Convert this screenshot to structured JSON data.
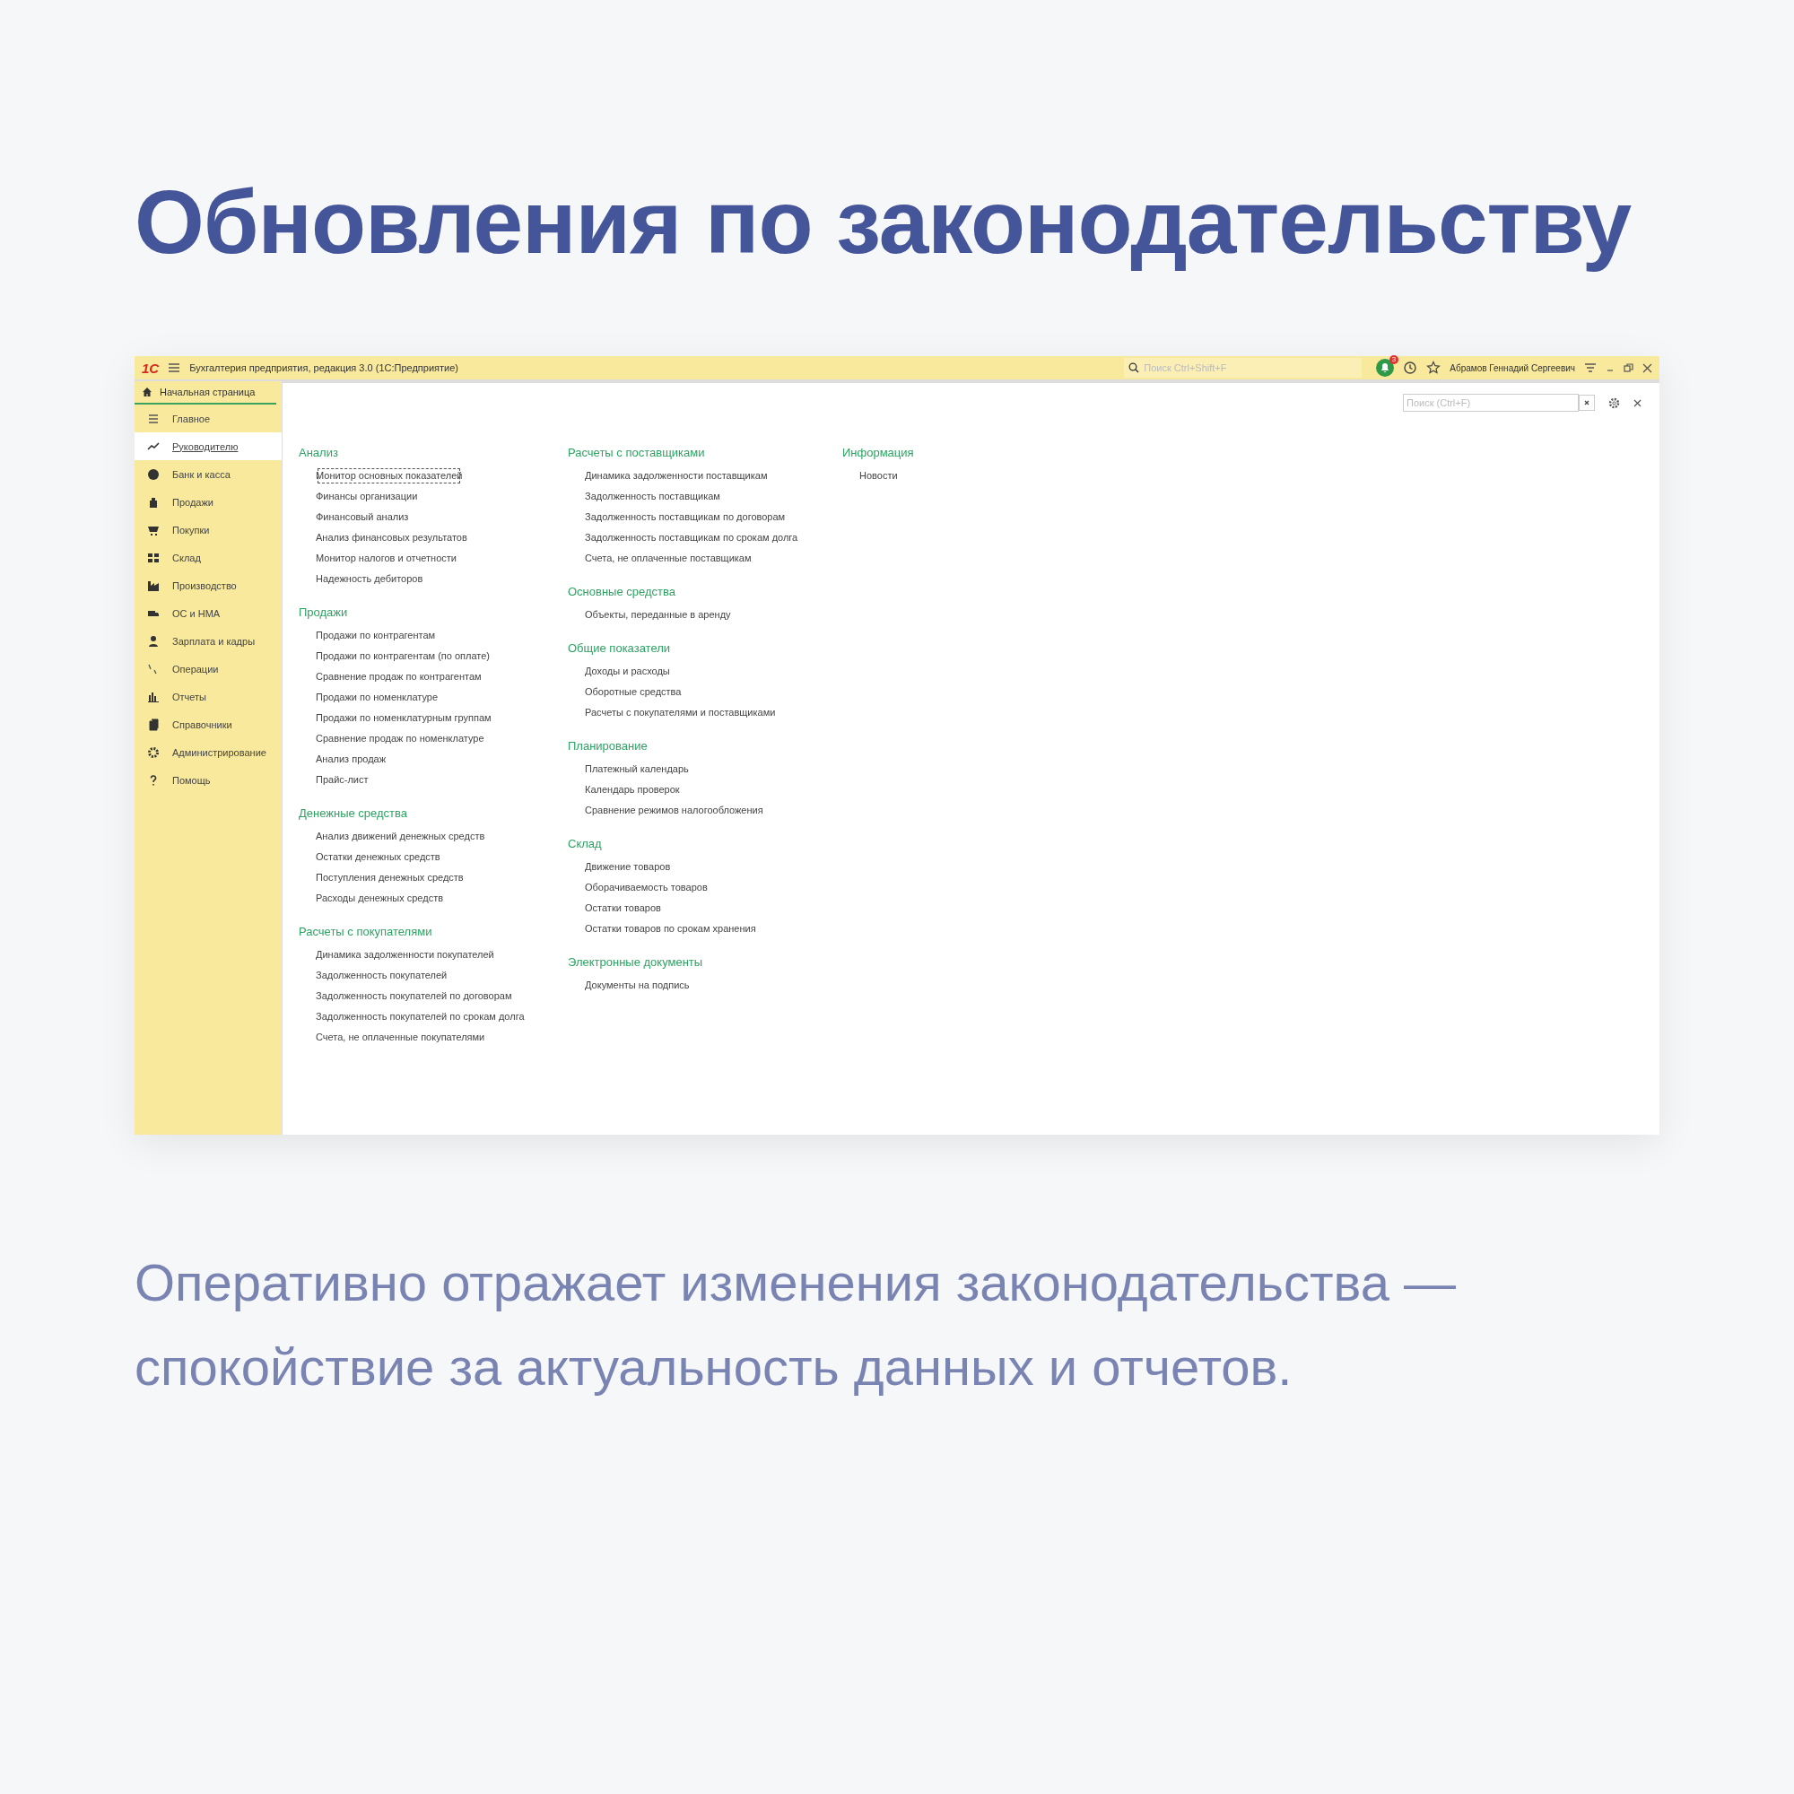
{
  "title": "Обновления по законодательству",
  "window": {
    "logo": "1С",
    "title": "Бухгалтерия предприятия, редакция 3.0  (1С:Предприятие)",
    "search": {
      "placeholder": "Поиск Ctrl+Shift+F"
    },
    "notifications": "3",
    "user": "Абрамов Геннадий Сергеевич"
  },
  "tab": {
    "label": "Начальная страница",
    "selected": true
  },
  "sidebar": {
    "items": [
      {
        "label": "Главное",
        "selected": false
      },
      {
        "label": "Руководителю",
        "selected": true
      },
      {
        "label": "Банк и касса",
        "selected": false
      },
      {
        "label": "Продажи",
        "selected": false
      },
      {
        "label": "Покупки",
        "selected": false
      },
      {
        "label": "Склад",
        "selected": false
      },
      {
        "label": "Производство",
        "selected": false
      },
      {
        "label": "ОС и НМА",
        "selected": false
      },
      {
        "label": "Зарплата и кадры",
        "selected": false
      },
      {
        "label": "Операции",
        "selected": false
      },
      {
        "label": "Отчеты",
        "selected": false
      },
      {
        "label": "Справочники",
        "selected": false
      },
      {
        "label": "Администрирование",
        "selected": false
      },
      {
        "label": "Помощь",
        "selected": false
      }
    ]
  },
  "content": {
    "search": {
      "placeholder": "Поиск (Ctrl+F)"
    },
    "columns": [
      [
        {
          "heading": "Анализ",
          "items": [
            {
              "label": "Монитор основных показателей",
              "focused": true
            },
            {
              "label": "Финансы организации",
              "focused": false
            },
            {
              "label": "Финансовый анализ",
              "focused": false
            },
            {
              "label": "Анализ финансовых результатов",
              "focused": false
            },
            {
              "label": "Монитор налогов и отчетности",
              "focused": false
            },
            {
              "label": "Надежность дебиторов",
              "focused": false
            }
          ]
        },
        {
          "heading": "Продажи",
          "items": [
            {
              "label": "Продажи по контрагентам",
              "focused": false
            },
            {
              "label": "Продажи по контрагентам (по оплате)",
              "focused": false
            },
            {
              "label": "Сравнение продаж по контрагентам",
              "focused": false
            },
            {
              "label": "Продажи по номенклатуре",
              "focused": false
            },
            {
              "label": "Продажи по номенклатурным группам",
              "focused": false
            },
            {
              "label": "Сравнение продаж по номенклатуре",
              "focused": false
            },
            {
              "label": "Анализ продаж",
              "focused": false
            },
            {
              "label": "Прайс-лист",
              "focused": false
            }
          ]
        },
        {
          "heading": "Денежные средства",
          "items": [
            {
              "label": "Анализ движений денежных средств",
              "focused": false
            },
            {
              "label": "Остатки денежных средств",
              "focused": false
            },
            {
              "label": "Поступления денежных средств",
              "focused": false
            },
            {
              "label": "Расходы денежных средств",
              "focused": false
            }
          ]
        },
        {
          "heading": "Расчеты с покупателями",
          "items": [
            {
              "label": "Динамика задолженности покупателей",
              "focused": false
            },
            {
              "label": "Задолженность покупателей",
              "focused": false
            },
            {
              "label": "Задолженность покупателей по договорам",
              "focused": false
            },
            {
              "label": "Задолженность покупателей по срокам долга",
              "focused": false
            },
            {
              "label": "Счета, не оплаченные покупателями",
              "focused": false
            }
          ]
        }
      ],
      [
        {
          "heading": "Расчеты с поставщиками",
          "items": [
            {
              "label": "Динамика задолженности поставщикам",
              "focused": false
            },
            {
              "label": "Задолженность поставщикам",
              "focused": false
            },
            {
              "label": "Задолженность поставщикам по договорам",
              "focused": false
            },
            {
              "label": "Задолженность поставщикам по срокам долга",
              "focused": false
            },
            {
              "label": "Счета, не оплаченные поставщикам",
              "focused": false
            }
          ]
        },
        {
          "heading": "Основные средства",
          "items": [
            {
              "label": "Объекты, переданные в аренду",
              "focused": false
            }
          ]
        },
        {
          "heading": "Общие показатели",
          "items": [
            {
              "label": "Доходы и расходы",
              "focused": false
            },
            {
              "label": "Оборотные средства",
              "focused": false
            },
            {
              "label": "Расчеты с покупателями и поставщиками",
              "focused": false
            }
          ]
        },
        {
          "heading": "Планирование",
          "items": [
            {
              "label": "Платежный календарь",
              "focused": false
            },
            {
              "label": "Календарь проверок",
              "focused": false
            },
            {
              "label": "Сравнение режимов налогообложения",
              "focused": false
            }
          ]
        },
        {
          "heading": "Склад",
          "items": [
            {
              "label": "Движение товаров",
              "focused": false
            },
            {
              "label": "Оборачиваемость товаров",
              "focused": false
            },
            {
              "label": "Остатки товаров",
              "focused": false
            },
            {
              "label": "Остатки товаров по срокам хранения",
              "focused": false
            }
          ]
        },
        {
          "heading": "Электронные документы",
          "items": [
            {
              "label": "Документы на подпись",
              "focused": false
            }
          ]
        }
      ],
      [
        {
          "heading": "Информация",
          "items": [
            {
              "label": "Новости",
              "focused": false
            }
          ]
        }
      ]
    ]
  },
  "description": "Оперативно отражает изменения законодательства — спокойствие за актуальность данных и отчетов."
}
